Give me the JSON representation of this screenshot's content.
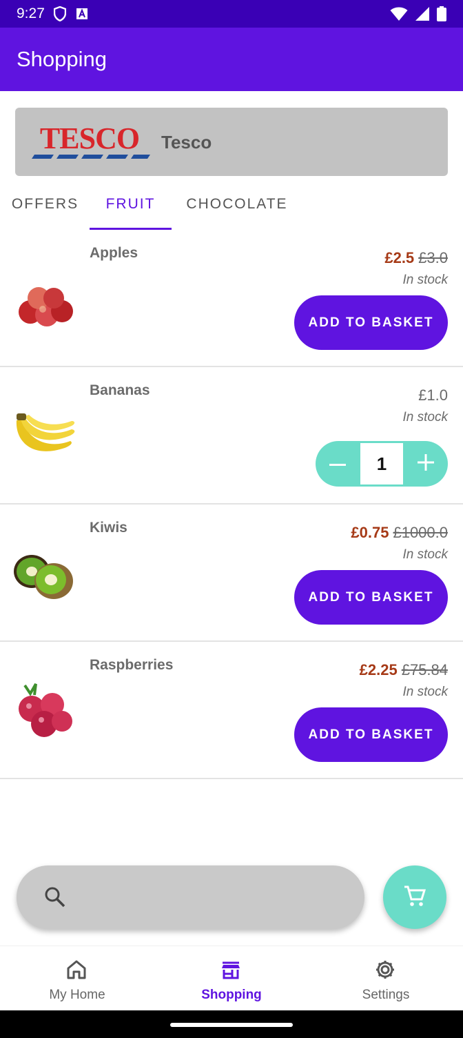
{
  "status_bar": {
    "time": "9:27",
    "left_icons": [
      "shield-icon",
      "a-notification-icon"
    ],
    "right_icons": [
      "wifi-icon",
      "signal-icon",
      "battery-icon"
    ]
  },
  "app_bar": {
    "title": "Shopping"
  },
  "store": {
    "name": "Tesco",
    "logo_text": "TESCO"
  },
  "tabs": [
    {
      "label": "OFFERS",
      "active": false
    },
    {
      "label": "FRUIT",
      "active": true
    },
    {
      "label": "CHOCOLATE",
      "active": false
    }
  ],
  "products": [
    {
      "name": "Apples",
      "price": "£2.5",
      "old_price": "£3.0",
      "stock": "In stock",
      "action": "ADD TO BASKET"
    },
    {
      "name": "Bananas",
      "price": "£1.0",
      "stock": "In stock",
      "quantity": "1"
    },
    {
      "name": "Kiwis",
      "price": "£0.75",
      "old_price": "£1000.0",
      "stock": "In stock",
      "action": "ADD TO BASKET"
    },
    {
      "name": "Raspberries",
      "price": "£2.25",
      "old_price": "£75.84",
      "stock": "In stock",
      "action": "ADD TO BASKET"
    }
  ],
  "search": {
    "placeholder": "",
    "icon": "search-icon"
  },
  "cart_fab": {
    "icon": "cart-icon"
  },
  "bottom_nav": [
    {
      "label": "My Home",
      "icon": "home-icon",
      "active": false
    },
    {
      "label": "Shopping",
      "icon": "store-icon",
      "active": true
    },
    {
      "label": "Settings",
      "icon": "gear-icon",
      "active": false
    }
  ],
  "colors": {
    "primary": "#5f14e0",
    "status_bar": "#3a00b5",
    "accent": "#6adcc8",
    "sale_price": "#a63a17",
    "store_card": "#c2c2c2"
  }
}
